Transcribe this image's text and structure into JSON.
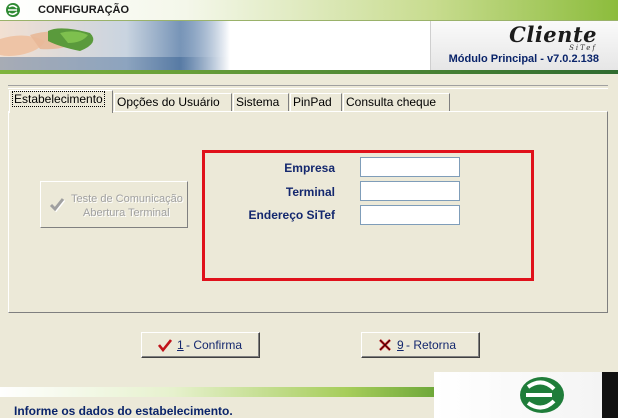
{
  "window": {
    "title": "CONFIGURAÇÃO"
  },
  "brand": {
    "name": "Cliente",
    "sub": "SiTef",
    "version": "Módulo Principal - v7.0.2.138"
  },
  "tabs": [
    {
      "label": "Estabelecimento",
      "active": true
    },
    {
      "label": "Opções do Usuário",
      "active": false
    },
    {
      "label": "Sistema",
      "active": false
    },
    {
      "label": "PinPad",
      "active": false
    },
    {
      "label": "Consulta cheque",
      "active": false
    }
  ],
  "test_button": {
    "line1": "Teste de Comunicação",
    "line2": "Abertura Terminal"
  },
  "fields": {
    "empresa": {
      "label": "Empresa",
      "value": ""
    },
    "terminal": {
      "label": "Terminal",
      "value": ""
    },
    "endereco": {
      "label": "Endereço SiTef",
      "value": ""
    }
  },
  "buttons": {
    "confirm": {
      "num": "1",
      "label": " - Confirma"
    },
    "return": {
      "num": "9",
      "label": " - Retorna"
    }
  },
  "status": {
    "message": "Informe os dados do estabelecimento."
  },
  "colors": {
    "accent_green": "#8cbc3c",
    "label_blue": "#14286e",
    "highlight_red": "#e0111b"
  }
}
